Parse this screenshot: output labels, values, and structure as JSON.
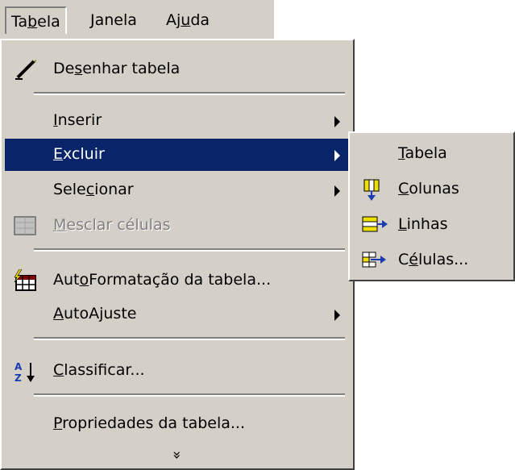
{
  "menubar": {
    "items": [
      {
        "pre": "Ta",
        "key": "b",
        "post": "ela"
      },
      {
        "pre": "",
        "key": "J",
        "post": "anela"
      },
      {
        "pre": "Aj",
        "key": "u",
        "post": "da"
      }
    ]
  },
  "menu": {
    "draw_table": {
      "pre": "De",
      "key": "s",
      "post": "enhar tabela"
    },
    "insert": {
      "pre": "",
      "key": "I",
      "post": "nserir"
    },
    "delete": {
      "pre": "",
      "key": "E",
      "post": "xcluir"
    },
    "select": {
      "pre": "Sele",
      "key": "c",
      "post": "ionar"
    },
    "merge": {
      "pre": "",
      "key": "M",
      "post": "esclar células"
    },
    "autoformat": {
      "pre": "Aut",
      "key": "o",
      "post": "Formatação da tabela..."
    },
    "autofit": {
      "pre": "",
      "key": "A",
      "post": "utoAjuste"
    },
    "sort": {
      "pre": "",
      "key": "C",
      "post": "lassificar..."
    },
    "properties": {
      "pre": "",
      "key": "P",
      "post": "ropriedades da tabela..."
    },
    "expand_glyph": "»"
  },
  "submenu": {
    "table": {
      "pre": "",
      "key": "T",
      "post": "abela"
    },
    "columns": {
      "pre": "",
      "key": "C",
      "post": "olunas"
    },
    "rows": {
      "pre": "",
      "key": "L",
      "post": "inhas"
    },
    "cells": {
      "pre": "C",
      "key": "é",
      "post": "lulas..."
    }
  },
  "colors": {
    "menu_bg": "#d4d0c8",
    "highlight": "#0a246a",
    "icon_blue": "#1a3ab0",
    "icon_yellow": "#f0e000"
  }
}
